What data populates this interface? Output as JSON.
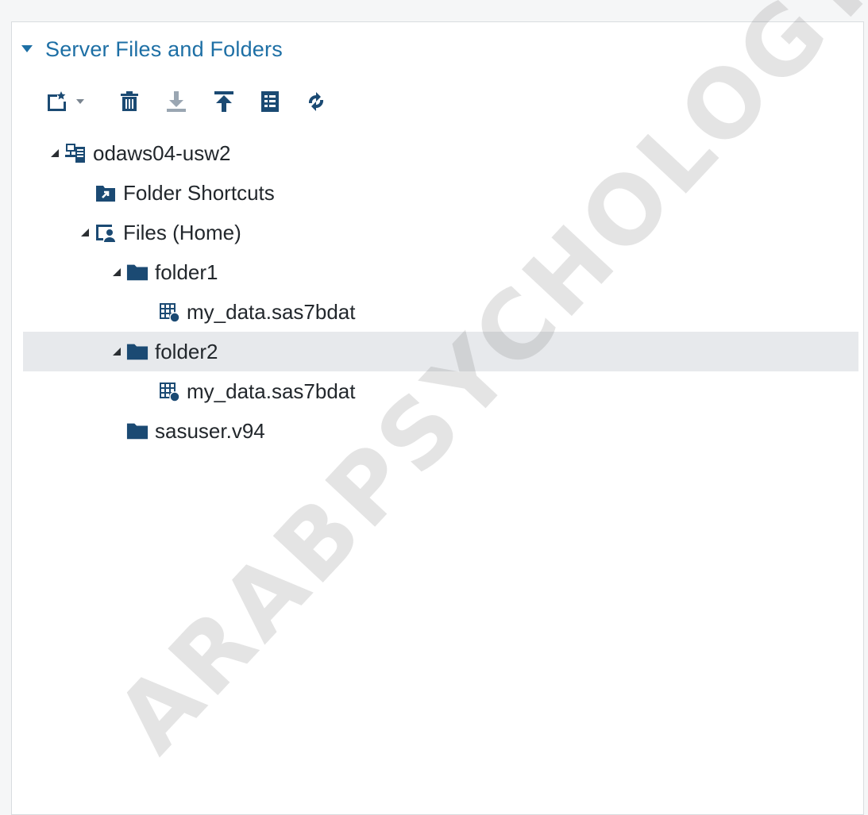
{
  "section": {
    "title": "Server Files and Folders",
    "expanded": true
  },
  "toolbar": {
    "buttons": [
      {
        "name": "new",
        "icon": "new-item-icon"
      },
      {
        "name": "delete",
        "icon": "trash-icon"
      },
      {
        "name": "download",
        "icon": "download-icon"
      },
      {
        "name": "upload",
        "icon": "upload-icon"
      },
      {
        "name": "properties",
        "icon": "properties-icon"
      },
      {
        "name": "refresh",
        "icon": "refresh-icon"
      }
    ]
  },
  "tree": {
    "server": {
      "label": "odaws04-usw2",
      "icon": "server-icon",
      "expanded": true
    },
    "shortcuts": {
      "label": "Folder Shortcuts",
      "icon": "folder-shortcut-icon"
    },
    "home": {
      "label": "Files (Home)",
      "icon": "home-files-icon",
      "expanded": true
    },
    "folder1": {
      "label": "folder1",
      "icon": "folder-icon",
      "expanded": true
    },
    "folder1_file": {
      "label": "my_data.sas7bdat",
      "icon": "dataset-icon"
    },
    "folder2": {
      "label": "folder2",
      "icon": "folder-icon",
      "expanded": true,
      "selected": true
    },
    "folder2_file": {
      "label": "my_data.sas7bdat",
      "icon": "dataset-icon"
    },
    "sasuser": {
      "label": "sasuser.v94",
      "icon": "folder-icon"
    }
  },
  "watermark": {
    "text": "ARABPSYCHOLOGY.COM"
  },
  "colors": {
    "accent": "#1d6fa5",
    "icon": "#1b4a73",
    "selected_row": "#e7e9ec",
    "disabled_icon": "#9aa6b2"
  }
}
